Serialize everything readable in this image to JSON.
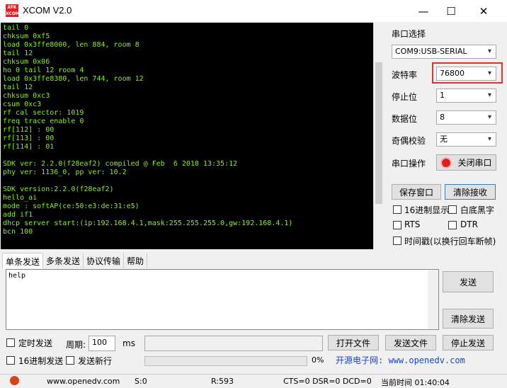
{
  "window": {
    "title": "XCOM V2.0",
    "logo_text": "ATK XCOM",
    "controls": [
      "—",
      "☐",
      "✕"
    ]
  },
  "terminal_lines": [
    "tail 0",
    "chksum 0xf5",
    "load 0x3ffe8000, len 884, room 8",
    "tail 12",
    "chksum 0x06",
    "ho 0 tail 12 room 4",
    "load 0x3ffe8380, len 744, room 12",
    "tail 12",
    "chksum 0xc3",
    "csum 0xc3",
    "rf cal sector: 1019",
    "freq trace enable 0",
    "rf[112] : 00",
    "rf[113] : 00",
    "rf[114] : 01",
    "",
    "SDK ver: 2.2.0(f28eaf2) compiled @ Feb  6 2018 13:35:12",
    "phy ver: 1136_0, pp ver: 10.2",
    "",
    "SDK version:2.2.0(f28eaf2)",
    "hello_ai",
    "mode : softAP(ce:50:e3:de:31:e5)",
    "add if1",
    "dhcp server start:(ip:192.168.4.1,mask:255.255.255.0,gw:192.168.4.1)",
    "bcn 100"
  ],
  "settings": {
    "port_label": "串口选择",
    "port_value": "COM9:USB-SERIAL",
    "baud_label": "波特率",
    "baud_value": "76800",
    "stop_label": "停止位",
    "stop_value": "1",
    "data_label": "数据位",
    "data_value": "8",
    "parity_label": "奇偶校验",
    "parity_value": "无",
    "op_label": "串口操作",
    "close_port": "关闭串口",
    "save_window": "保存窗口",
    "clear_recv": "清除接收",
    "hex_display": "16进制显示",
    "white_black": "白底黑字",
    "rts": "RTS",
    "dtr": "DTR",
    "timestamp": "时间戳(以换行回车断帧)"
  },
  "tabs": [
    "单条发送",
    "多条发送",
    "协议传输",
    "帮助"
  ],
  "send": {
    "text": "help",
    "send_btn": "发送",
    "clear_send": "清除发送",
    "timed_send": "定时发送",
    "period_label": "周期:",
    "period_value": "100",
    "ms": "ms",
    "open_file": "打开文件",
    "send_file": "发送文件",
    "stop_send": "停止发送",
    "hex_send": "16进制发送",
    "send_newline": "发送新行",
    "progress": "0%",
    "brand": "开源电子网: www.openedv.com"
  },
  "status": {
    "url": "www.openedv.com",
    "s": "S:0",
    "r": "R:593",
    "lines": "CTS=0 DSR=0 DCD=0",
    "time": "当前时间 01:40:04"
  }
}
